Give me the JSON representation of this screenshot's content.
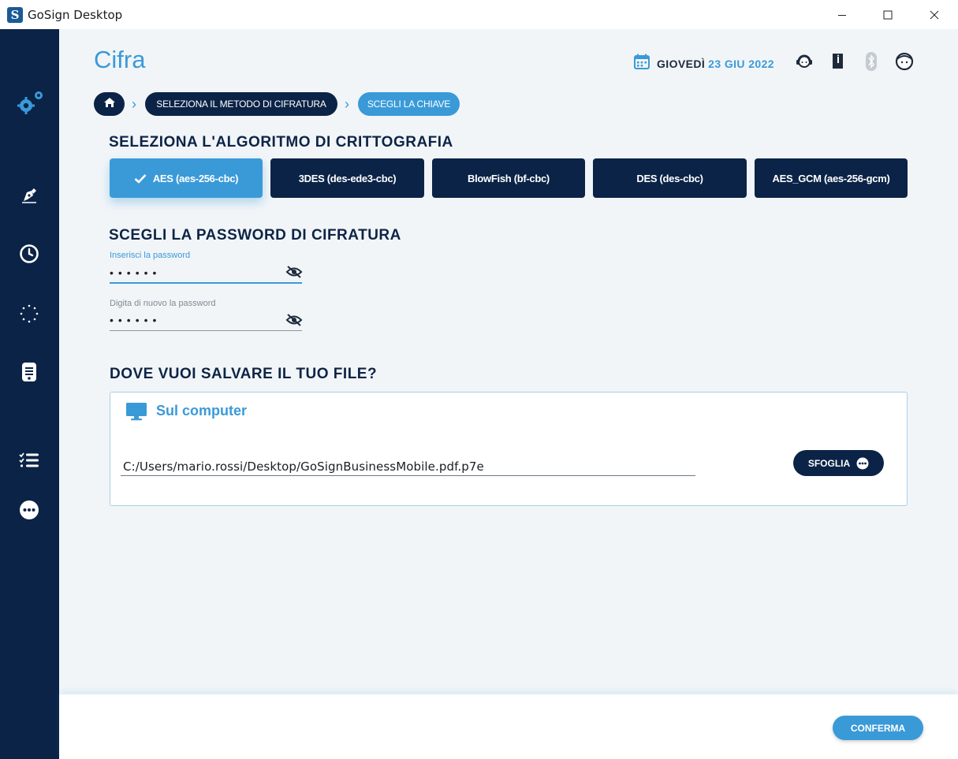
{
  "window": {
    "title": "GoSign Desktop",
    "controls": [
      "minimize-icon",
      "maximize-icon",
      "close-icon"
    ]
  },
  "sidebar": {
    "items": [
      {
        "icon": "gears-icon"
      },
      {
        "icon": "pen-sign-icon"
      },
      {
        "icon": "clock-icon"
      },
      {
        "icon": "loading-dots-icon"
      },
      {
        "icon": "document-list-icon"
      },
      {
        "icon": "tasks-list-icon"
      },
      {
        "icon": "more-icon"
      }
    ]
  },
  "header": {
    "page_title": "Cifra",
    "date_day": "GIOVEDÌ",
    "date_value": "23 GIU 2022",
    "icons": [
      "calendar-icon",
      "support-headset-icon",
      "manual-book-icon",
      "bluetooth-icon",
      "user-avatar-icon"
    ]
  },
  "breadcrumb": {
    "home_icon": "home-icon",
    "steps": [
      "SELEZIONA IL METODO DI CIFRATURA",
      "SCEGLI LA CHIAVE"
    ]
  },
  "algorithm": {
    "heading": "SELEZIONA L'ALGORITMO DI CRITTOGRAFIA",
    "options": [
      "AES (aes-256-cbc)",
      "3DES (des-ede3-cbc)",
      "BlowFish (bf-cbc)",
      "DES (des-cbc)",
      "AES_GCM (aes-256-gcm)"
    ],
    "selected": "AES (aes-256-cbc)"
  },
  "password": {
    "heading": "SCEGLI LA PASSWORD DI CIFRATURA",
    "field1_label": "Inserisci la password",
    "field1_value": "••••••",
    "field2_label": "Digita di nuovo la password",
    "field2_value": "••••••"
  },
  "save": {
    "heading": "DOVE VUOI SALVARE IL TUO FILE?",
    "option_label": "Sul computer",
    "path": "C:/Users/mario.rossi/Desktop/GoSignBusinessMobile.pdf.p7e",
    "browse_label": "SFOGLIA"
  },
  "footer": {
    "confirm_label": "CONFERMA"
  },
  "colors": {
    "navy": "#0b2347",
    "accent": "#3a9ad8",
    "background": "#f1f5f8"
  }
}
